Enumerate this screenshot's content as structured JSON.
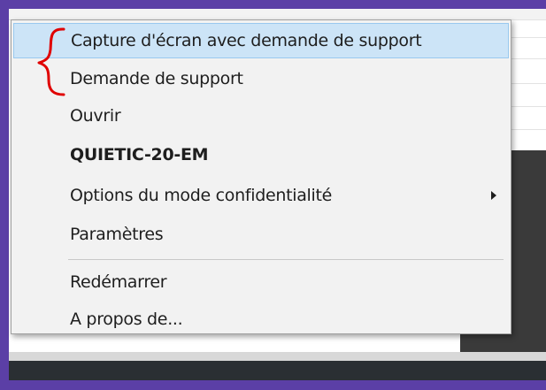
{
  "context_menu": {
    "items": [
      {
        "label": "Capture d'écran avec demande de support",
        "highlighted": true
      },
      {
        "label": "Demande de support"
      },
      {
        "label": "Ouvrir"
      },
      {
        "label": "QUIETIC-20-EM",
        "bold": true
      },
      {
        "label": "Options du mode confidentialité",
        "has_submenu": true
      },
      {
        "label": "Paramètres"
      },
      {
        "label": "Redémarrer"
      },
      {
        "label": "A propos de..."
      }
    ]
  },
  "colors": {
    "background_border": "#5b3fa6",
    "menu_background": "#f2f2f2",
    "highlight": "#cce4f7",
    "annotation": "#e00000"
  },
  "icons": {
    "submenu_arrow": "chevron-right-icon",
    "annotation": "red-brace-annotation"
  }
}
